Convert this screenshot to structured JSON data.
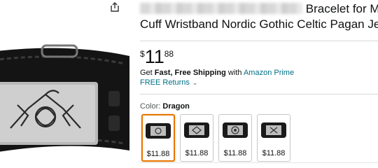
{
  "product": {
    "title_line1_visible": "Bracelet for M",
    "title_line2": "Cuff Wristband Nordic Gothic Celtic Pagan Jew",
    "price_symbol": "$",
    "price_whole": "11",
    "price_fraction": "88",
    "shipping_prefix": "Get ",
    "shipping_bold": "Fast, Free Shipping",
    "shipping_with": " with ",
    "shipping_prime": "Amazon Prime",
    "returns": "FREE Returns",
    "color_prefix": "Color: ",
    "color_value": "Dragon"
  },
  "swatches": [
    {
      "price": "$11.88",
      "selected": true
    },
    {
      "price": "$11.88",
      "selected": false
    },
    {
      "price": "$11.88",
      "selected": false
    },
    {
      "price": "$11.88",
      "selected": false
    }
  ],
  "colors": {
    "link": "#007185",
    "selected_border": "#e77600",
    "text": "#0f1111"
  },
  "icons": {
    "share": "share-icon",
    "returns_chevron": "chevron-down-icon"
  }
}
